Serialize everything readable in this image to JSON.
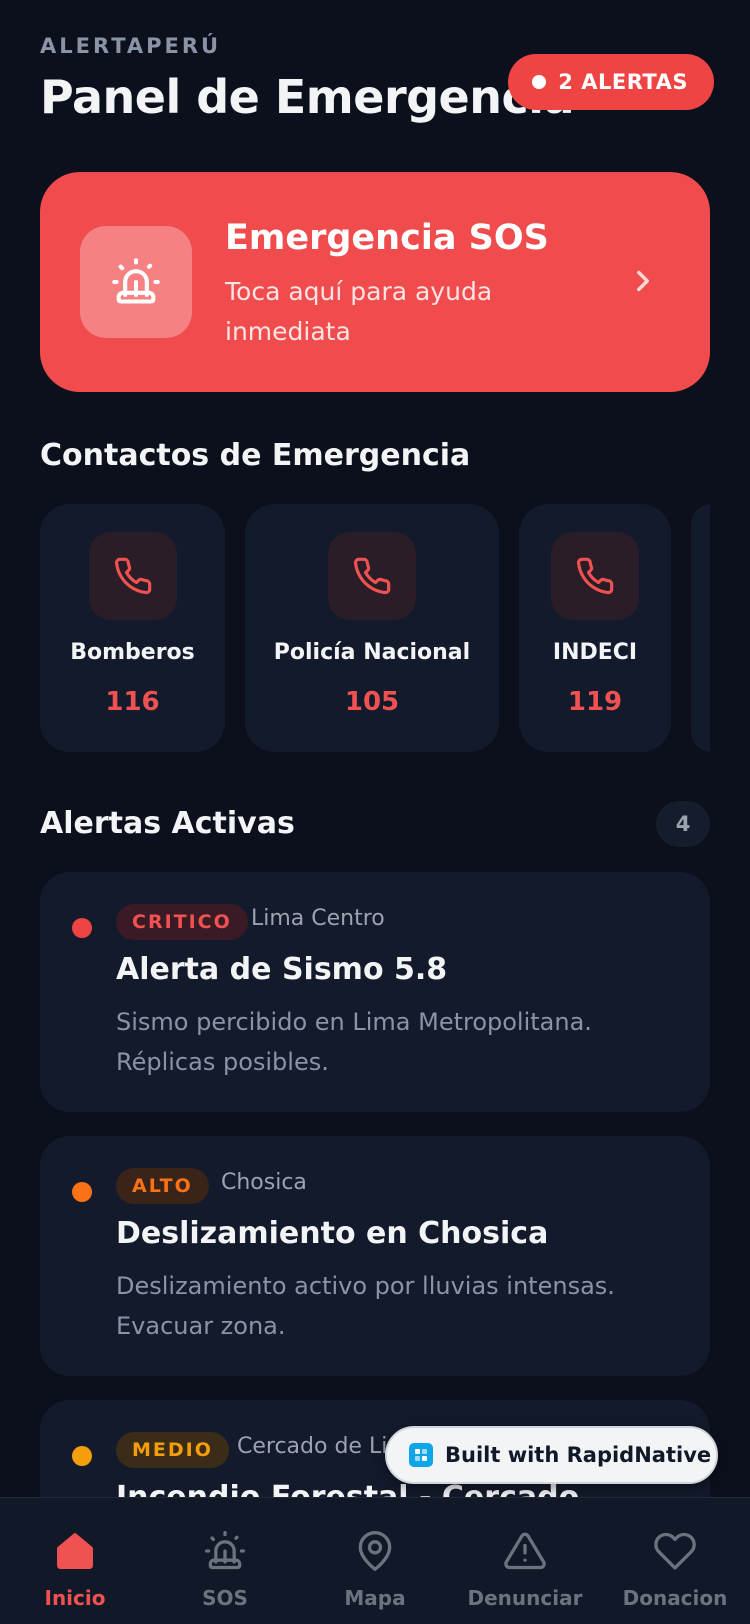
{
  "header": {
    "app_name": "ALERTAPERÚ",
    "title": "Panel de Emergencia",
    "alert_badge": "2 ALERTAS"
  },
  "sos": {
    "title": "Emergencia SOS",
    "subtitle": "Toca aquí para ayuda inmediata",
    "icon": "siren-icon"
  },
  "contacts": {
    "section_title": "Contactos de Emergencia",
    "items": [
      {
        "name": "Bomberos",
        "number": "116"
      },
      {
        "name": "Policía Nacional",
        "number": "105"
      },
      {
        "name": "INDECI",
        "number": "119"
      }
    ]
  },
  "alerts": {
    "section_title": "Alertas Activas",
    "count": "4",
    "items": [
      {
        "level": "CRITICO",
        "location": "Lima Centro",
        "title": "Alerta de Sismo 5.8",
        "description": "Sismo percibido en Lima Metropolitana. Réplicas posibles.",
        "color": "#ef4444"
      },
      {
        "level": "ALTO",
        "location": "Chosica",
        "title": "Deslizamiento en Chosica",
        "description": "Deslizamiento activo por lluvias intensas. Evacuar zona.",
        "color": "#f97316"
      },
      {
        "level": "MEDIO",
        "location": "Cercado de Li",
        "title": "Incendio Forestal - Cercado",
        "description": "",
        "color": "#f59e0b"
      }
    ]
  },
  "built_with": "Built with RapidNative",
  "nav": {
    "items": [
      {
        "label": "Inicio",
        "icon": "home-icon"
      },
      {
        "label": "SOS",
        "icon": "siren-icon"
      },
      {
        "label": "Mapa",
        "icon": "map-pin-icon"
      },
      {
        "label": "Denunciar",
        "icon": "warning-icon"
      },
      {
        "label": "Donacion",
        "icon": "heart-icon"
      }
    ]
  },
  "colors": {
    "background": "#0b101c",
    "card": "#131a2b",
    "accent": "#ef4444",
    "sos": "#f04c4d"
  }
}
